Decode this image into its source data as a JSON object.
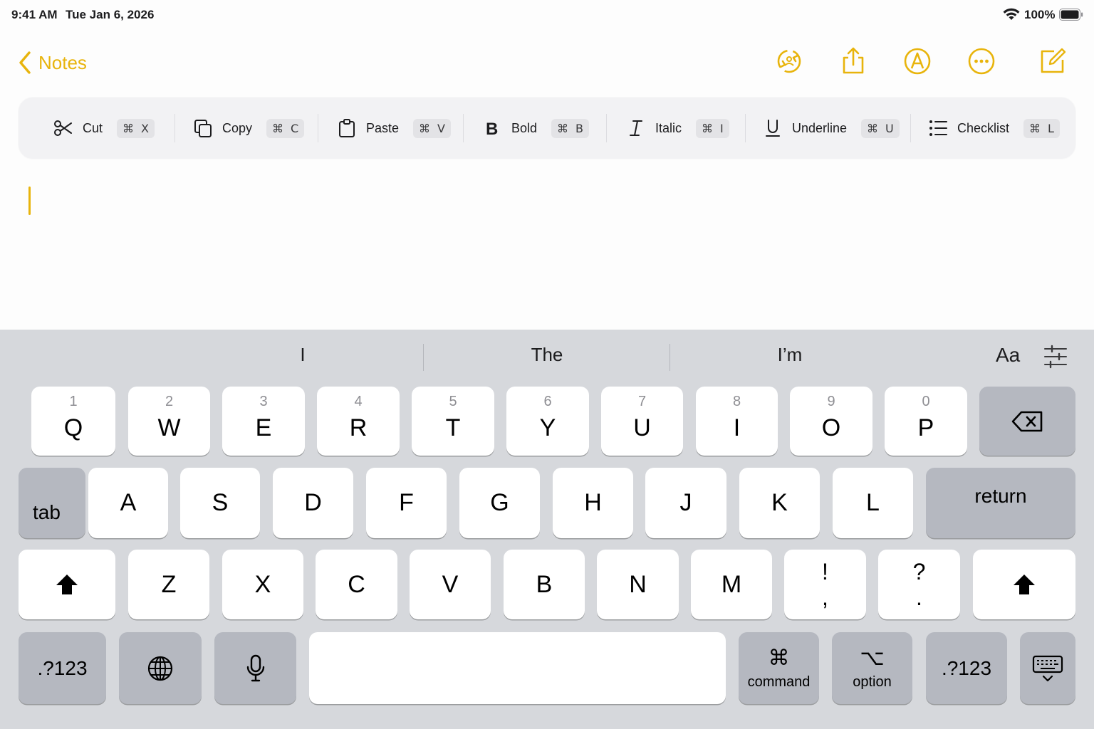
{
  "status_bar": {
    "time": "9:41 AM",
    "date": "Tue Jan 6, 2026",
    "battery": "100%"
  },
  "nav": {
    "back_label": "Notes",
    "accent_color": "#e8b40c"
  },
  "format_toolbar": {
    "items": [
      {
        "label": "Cut",
        "icon": "scissors-icon",
        "shortcut_mod": "⌘",
        "shortcut_key": "X"
      },
      {
        "label": "Copy",
        "icon": "copy-icon",
        "shortcut_mod": "⌘",
        "shortcut_key": "C"
      },
      {
        "label": "Paste",
        "icon": "clipboard-icon",
        "shortcut_mod": "⌘",
        "shortcut_key": "V"
      },
      {
        "label": "Bold",
        "icon": "bold-icon",
        "shortcut_mod": "⌘",
        "shortcut_key": "B"
      },
      {
        "label": "Italic",
        "icon": "italic-icon",
        "shortcut_mod": "⌘",
        "shortcut_key": "I"
      },
      {
        "label": "Underline",
        "icon": "underline-icon",
        "shortcut_mod": "⌘",
        "shortcut_key": "U"
      },
      {
        "label": "Checklist",
        "icon": "checklist-icon",
        "shortcut_mod": "⌘",
        "shortcut_key": "L"
      }
    ]
  },
  "keyboard": {
    "suggestions": [
      "I",
      "The",
      "I’m"
    ],
    "format_label": "Aa",
    "row1": [
      {
        "main": "Q",
        "hint": "1"
      },
      {
        "main": "W",
        "hint": "2"
      },
      {
        "main": "E",
        "hint": "3"
      },
      {
        "main": "R",
        "hint": "4"
      },
      {
        "main": "T",
        "hint": "5"
      },
      {
        "main": "Y",
        "hint": "6"
      },
      {
        "main": "U",
        "hint": "7"
      },
      {
        "main": "I",
        "hint": "8"
      },
      {
        "main": "O",
        "hint": "9"
      },
      {
        "main": "P",
        "hint": "0"
      }
    ],
    "tab_label": "tab",
    "row2": [
      "A",
      "S",
      "D",
      "F",
      "G",
      "H",
      "J",
      "K",
      "L"
    ],
    "return_label": "return",
    "row3": [
      "Z",
      "X",
      "C",
      "V",
      "B",
      "N",
      "M"
    ],
    "punct1": {
      "top": "!",
      "bottom": ","
    },
    "punct2": {
      "top": "?",
      "bottom": "."
    },
    "numbers_label": ".?123",
    "command": {
      "glyph": "⌘",
      "label": "command"
    },
    "option": {
      "glyph": "⌥",
      "label": "option"
    }
  }
}
